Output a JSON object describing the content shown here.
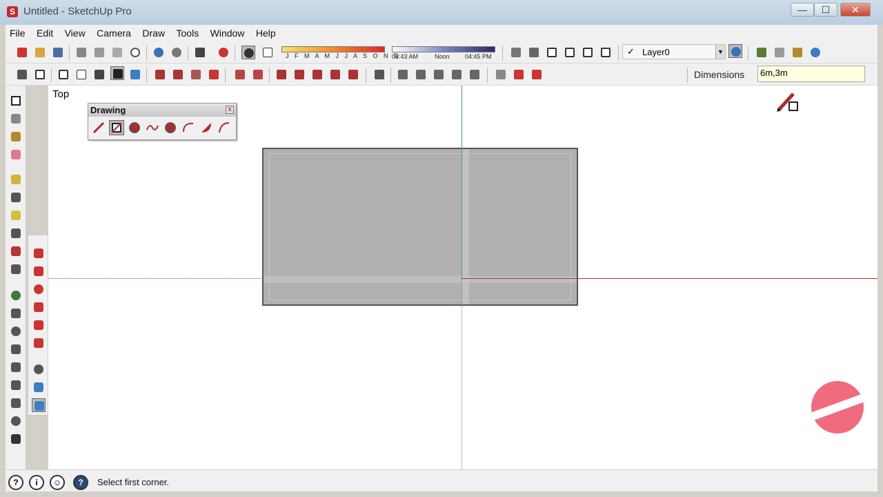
{
  "window": {
    "title": "Untitled - SketchUp Pro",
    "minimize": "—",
    "maximize": "☐",
    "close": "✕"
  },
  "menu": [
    "File",
    "Edit",
    "View",
    "Camera",
    "Draw",
    "Tools",
    "Window",
    "Help"
  ],
  "shadows": {
    "months": "J F M A M J J A S O N D",
    "time_start": "06:43 AM",
    "time_mid": "Noon",
    "time_end": "04:45 PM"
  },
  "layer": {
    "checked": "✓",
    "name": "Layer0"
  },
  "vcb": {
    "label": "Dimensions",
    "value": "6m,3m"
  },
  "viewport": {
    "view_name": "Top"
  },
  "drawing_palette": {
    "title": "Drawing",
    "close": "x",
    "tools": [
      "pencil-icon",
      "rectangle-icon",
      "circle-icon",
      "freehand-icon",
      "polygon-icon",
      "arc-icon",
      "pie-icon",
      "2-point-arc-icon"
    ],
    "selected": "rectangle-icon"
  },
  "status": {
    "text": "Select first corner."
  },
  "colors": {
    "green_axis": "#57a057",
    "red_axis": "#b23232",
    "face": "#b0b0b0",
    "logo": "#f06b7e"
  }
}
